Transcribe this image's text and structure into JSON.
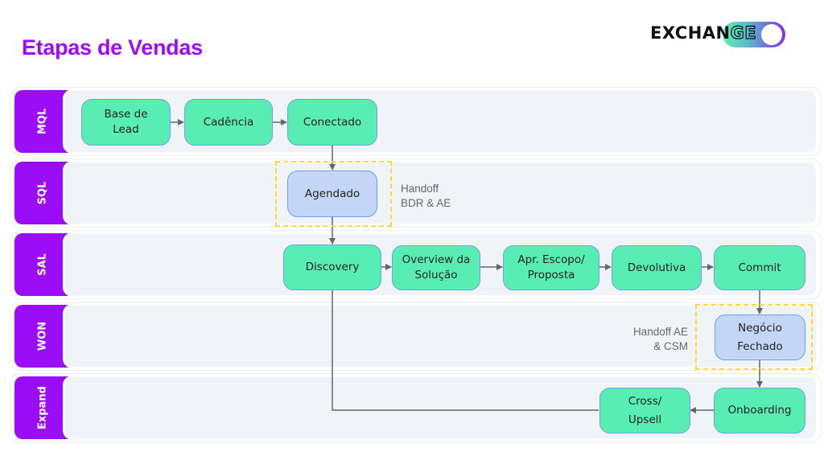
{
  "title": "Etapas de Vendas",
  "logo": {
    "text_solid": "EXCHAN",
    "text_outline": "GE",
    "toggle_state": "on"
  },
  "colors": {
    "accent": "#9b0cf7",
    "stage_green": "#58eeb3",
    "handoff_blue": "#c3d6f6",
    "handoff_border": "#fadb3a",
    "connector": "#666666"
  },
  "lanes": [
    {
      "id": "mql",
      "label": "MQL"
    },
    {
      "id": "sql",
      "label": "SQL"
    },
    {
      "id": "sal",
      "label": "SAL"
    },
    {
      "id": "won",
      "label": "WON"
    },
    {
      "id": "expand",
      "label": "Expand"
    }
  ],
  "nodes": {
    "base_lead": "Base de\nLead",
    "cadencia": "Cadência",
    "conectado": "Conectado",
    "agendado": "Agendado",
    "discovery": "Discovery",
    "overview": "Overview da\nSolução",
    "apr_escopo": "Apr. Escopo/\nProposta",
    "devolutiva": "Devolutiva",
    "commit": "Commit",
    "negocio_fechado": "Negócio\nFechado",
    "onboarding": "Onboarding",
    "cross_upsell": "Cross/\nUpsell"
  },
  "notes": {
    "handoff_bdr_ae": "Handoff\nBDR & AE",
    "handoff_ae_csm": "Handoff AE\n& CSM"
  },
  "flow": [
    [
      "base_lead",
      "cadencia"
    ],
    [
      "cadencia",
      "conectado"
    ],
    [
      "conectado",
      "agendado"
    ],
    [
      "agendado",
      "discovery"
    ],
    [
      "discovery",
      "overview"
    ],
    [
      "overview",
      "apr_escopo"
    ],
    [
      "apr_escopo",
      "devolutiva"
    ],
    [
      "devolutiva",
      "commit"
    ],
    [
      "commit",
      "negocio_fechado"
    ],
    [
      "negocio_fechado",
      "onboarding"
    ],
    [
      "onboarding",
      "cross_upsell"
    ],
    [
      "discovery",
      "cross_upsell"
    ]
  ]
}
